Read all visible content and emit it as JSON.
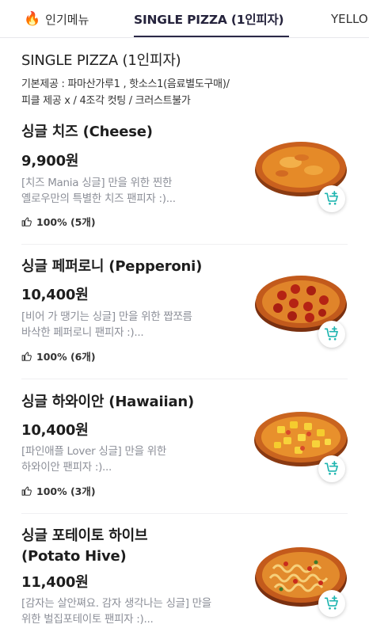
{
  "tabs": [
    {
      "icon": "fire-icon",
      "label": "인기메뉴",
      "active": false
    },
    {
      "label": "SINGLE PIZZA (1인피자)",
      "active": true
    },
    {
      "label": "YELLO",
      "active": false
    }
  ],
  "section": {
    "title": "SINGLE PIZZA (1인피자)",
    "desc_line1": "기본제공 : 파마산가루1 , 핫소스1(음료별도구매)/",
    "desc_line2": "피클 제공 x / 4조각 컷팅 / 크러스트불가"
  },
  "items": [
    {
      "name": "싱글 치즈 (Cheese)",
      "price": "9,900원",
      "desc_line1": "[치즈 Mania 싱글] 만을 위한 찐한",
      "desc_line2": "옐로우만의 특별한 치즈 팬피자 :)...",
      "rating": "100% (5개)",
      "image": "cheese-pizza"
    },
    {
      "name": "싱글 페퍼로니 (Pepperoni)",
      "price": "10,400원",
      "desc_line1": "[비어 가 땡기는 싱글] 만을 위한 짭쪼름",
      "desc_line2": "바삭한 페퍼로니 팬피자 :)...",
      "rating": "100% (6개)",
      "image": "pepperoni-pizza"
    },
    {
      "name": "싱글 하와이안 (Hawaiian)",
      "price": "10,400원",
      "desc_line1": "[파인애플 Lover 싱글] 만을 위한",
      "desc_line2": "하와이안 팬피자 :)...",
      "rating": "100% (3개)",
      "image": "hawaiian-pizza"
    },
    {
      "name_line1": "싱글 포테이토 하이브",
      "name_line2": "(Potato Hive)",
      "price": "11,400원",
      "desc_line1": "[감자는 살안쪄요. 감자 생각나는 싱글] 만을",
      "desc_line2": "위한 벌집포테이토 팬피자 :)...",
      "image": "potato-hive-pizza"
    }
  ],
  "colors": {
    "accent": "#2a2847",
    "cart_icon": "#1fb5b0",
    "desc_text": "#8c8f98"
  }
}
